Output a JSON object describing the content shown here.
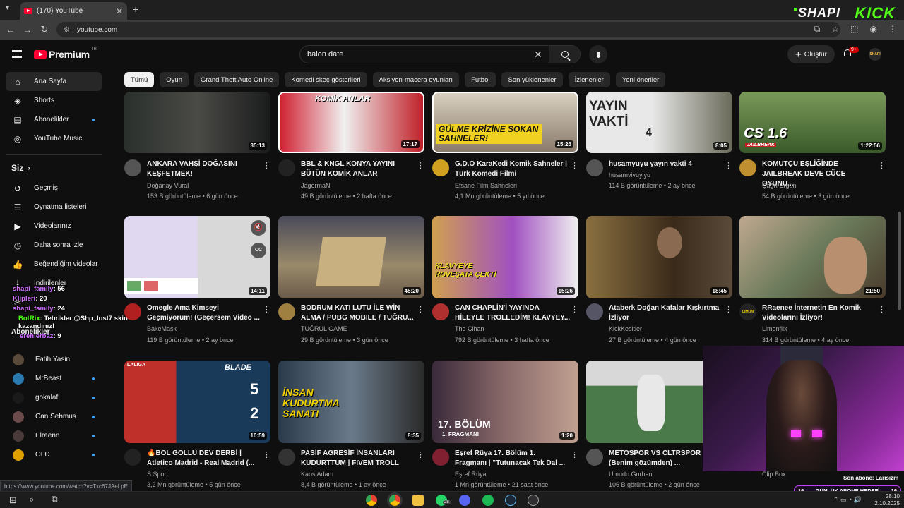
{
  "browser": {
    "tab_title": "(170) YouTube",
    "url": "youtube.com",
    "status_url": "https://www.youtube.com/watch?v=Txc67JAeLpE"
  },
  "overlay": {
    "shapi": "SHAPI",
    "kick": "KICK",
    "chat": [
      {
        "user": "shapi_family",
        "msg": ": 56"
      },
      {
        "user": "Klipleri",
        "msg": ": 20"
      },
      {
        "user": "shapi_family",
        "msg": ": 24"
      },
      {
        "user": "BotRix",
        "msg": ": Tebrikler @Shp_lost7 skin kazandınız!"
      },
      {
        "user": "erenlerbaz",
        "msg": ": 9"
      }
    ],
    "last_sub": "Son abone: Larisizm",
    "goal_left": "16",
    "goal_label": "GÜNLÜK ABONE HEDEFİ",
    "goal_right": "16",
    "goal_progress": 1.0
  },
  "yt": {
    "logo": "Premium",
    "logo_tr": "TR",
    "search_query": "balon date",
    "create_label": "Oluştur",
    "notif_badge": "9+",
    "avatar_text": "SHAPI"
  },
  "sidebar": {
    "main": [
      {
        "label": "Ana Sayfa",
        "icon": "home-icon"
      },
      {
        "label": "Shorts",
        "icon": "shorts-icon"
      },
      {
        "label": "Abonelikler",
        "icon": "subscriptions-icon"
      },
      {
        "label": "YouTube Music",
        "icon": "music-icon"
      }
    ],
    "you_header": "Siz",
    "you": [
      {
        "label": "Geçmiş",
        "icon": "history-icon"
      },
      {
        "label": "Oynatma listeleri",
        "icon": "playlist-icon"
      },
      {
        "label": "Videolarınız",
        "icon": "video-icon"
      },
      {
        "label": "Daha sonra izle",
        "icon": "clock-icon"
      },
      {
        "label": "Beğendiğim videolar",
        "icon": "like-icon"
      },
      {
        "label": "İndirilenler",
        "icon": "download-icon"
      }
    ],
    "subs_header": "Abonelikler",
    "subs": [
      {
        "label": "Fatih Yasin",
        "color": "#5a4a3a"
      },
      {
        "label": "MrBeast",
        "color": "#2a7ab0"
      },
      {
        "label": "gokalaf",
        "color": "#1a1a1a"
      },
      {
        "label": "Can Sehmus",
        "color": "#6a4a4a"
      },
      {
        "label": "Elraenn",
        "color": "#4a3a3a"
      },
      {
        "label": "OLD",
        "color": "#e0a000"
      }
    ]
  },
  "chips": [
    "Tümü",
    "Oyun",
    "Grand Theft Auto Online",
    "Komedi skeç gösterileri",
    "Aksiyon-macera oyunları",
    "Futbol",
    "Son yüklenenler",
    "İzlenenler",
    "Yeni öneriler"
  ],
  "videos": [
    {
      "title1": "ANKARA VAHŞİ DOĞASINI",
      "title2": "KEŞFETMEK!",
      "channel": "Doğanay Vural",
      "meta": "153 B görüntüleme • 6 gün önce",
      "dur": "35:13",
      "thumb_color": "#2a2e2a",
      "av_color": "#555"
    },
    {
      "title1": "BBL & KNGL KONYA YAYINI",
      "title2": "BÜTÜN KOMİK ANLAR",
      "channel": "JagermaN",
      "meta": "49 B görüntüleme • 2 hafta önce",
      "dur": "17:17",
      "thumb_color": "#b02030",
      "av_color": "#222"
    },
    {
      "title1": "G.D.O KaraKedi Komik Sahneler |",
      "title2": "Türk Komedi Filmi",
      "channel": "Efsane Film Sahneleri",
      "meta": "4,1 Mn görüntüleme • 5 yıl önce",
      "dur": "15:26",
      "thumb_color": "#6a5a4a",
      "av_color": "#d0a020"
    },
    {
      "title1": "husamyuyu yayın vakti 4",
      "title2": "",
      "channel": "husamvivuyiyu",
      "meta": "114 B görüntüleme • 2 ay önce",
      "dur": "8:05",
      "thumb_color": "#3a3a3a",
      "av_color": "#555"
    },
    {
      "title1": "KOMUTÇU EŞLİĞİNDE",
      "title2": "JAILBREAK DEVE CÜCE OYUNU...",
      "channel": "Çağrı Ergün",
      "meta": "54 B görüntüleme • 3 gün önce",
      "dur": "1:22:56",
      "thumb_color": "#4a6a3a",
      "av_color": "#c09030"
    },
    {
      "title1": "Omegle Ama Kimseyi",
      "title2": "Geçmiyorum! (Geçersem Video ...",
      "channel": "BakeMask",
      "meta": "119 B görüntüleme • 2 ay önce",
      "dur": "14:11",
      "thumb_color": "#ffffff",
      "av_color": "#b02020"
    },
    {
      "title1": "BODRUM KATI LUTU İLE WİN",
      "title2": "ALMA / PUBG MOBILE / TUĞRU...",
      "channel": "TUĞRUL GAME",
      "meta": "29 B görüntüleme • 3 gün önce",
      "dur": "45:20",
      "thumb_color": "#5a5040",
      "av_color": "#a08040"
    },
    {
      "title1": "CAN CHAPLİN'İ YAYINDA",
      "title2": "HİLEYLE TROLLEDİM! KLAVYEY...",
      "channel": "The Cihan",
      "meta": "792 B görüntüleme • 3 hafta önce",
      "dur": "15:26",
      "thumb_color": "#8040a0",
      "av_color": "#b03030"
    },
    {
      "title1": "Ataberk Doğan Kafalar Kışkırtma",
      "title2": "İzliyor",
      "channel": "KickKesitler",
      "meta": "27 B görüntüleme • 4 gün önce",
      "dur": "18:45",
      "thumb_color": "#6a5030",
      "av_color": "#556"
    },
    {
      "title1": "RRaenee İnternetin En Komik",
      "title2": "Videolarını İzliyor!",
      "channel": "Limonflix",
      "meta": "314 B görüntüleme • 4 ay önce",
      "dur": "21:50",
      "thumb_color": "#7a6a5a",
      "av_color": "#222"
    },
    {
      "title1": "🔥BOL GOLLÜ DEV DERBİ |",
      "title2": "Atletico Madrid - Real Madrid (...",
      "channel": "S Sport",
      "meta": "3,2 Mn görüntüleme • 5 gün önce",
      "dur": "10:59",
      "thumb_color": "#1a3a5a",
      "av_color": "#222"
    },
    {
      "title1": "PASİF AGRESİF İNSANLARI",
      "title2": "KUDURTTUM | FIVEM TROLL",
      "channel": "Kaos Adam",
      "meta": "8,4 B görüntüleme • 1 ay önce",
      "dur": "8:35",
      "thumb_color": "#2a3a4a",
      "av_color": "#333"
    },
    {
      "title1": "Eşref Rüya 17. Bölüm 1.",
      "title2": "Fragmanı | \"Tutunacak Tek Dal ...",
      "channel": "Eşref Rüya",
      "meta": "1 Mn görüntüleme • 21 saat önce",
      "dur": "1:20",
      "thumb_color": "#3a2a3a",
      "av_color": "#802030"
    },
    {
      "title1": "METOSPOR VS CLTRSPOR",
      "title2": "(Benim gözümden) ...",
      "channel": "Umudo Gurban",
      "meta": "106 B görüntüleme • 2 gün önce",
      "dur": "",
      "thumb_color": "#3a5a3a",
      "av_color": "#555"
    },
    {
      "title1": "",
      "title2": "",
      "channel": "Clip Box",
      "meta": "",
      "dur": "",
      "thumb_color": "#222",
      "av_color": "#333"
    }
  ],
  "thumb_text": {
    "v1": "KOMİK ANLAR",
    "v2": "GÜLME KRİZİNE SOKAN SAHNELER!",
    "v3": "YAYIN VAKTİ",
    "v3b": "4",
    "v4": "CS 1.6",
    "v4b": "JAILBREAK",
    "v7": "KLAVYEYE ROVEŞATA ÇEKTİ",
    "v10": "BLADE",
    "v10a": "5",
    "v10b": "2",
    "v10c": "LALIGA",
    "v11": "İNSAN KUDURTMA SANATI",
    "v12": "17. BÖLÜM",
    "v12b": "1. FRAGMANI"
  },
  "taskbar": {
    "time": "28:10",
    "date": "2.10.2025",
    "badge": "28"
  }
}
